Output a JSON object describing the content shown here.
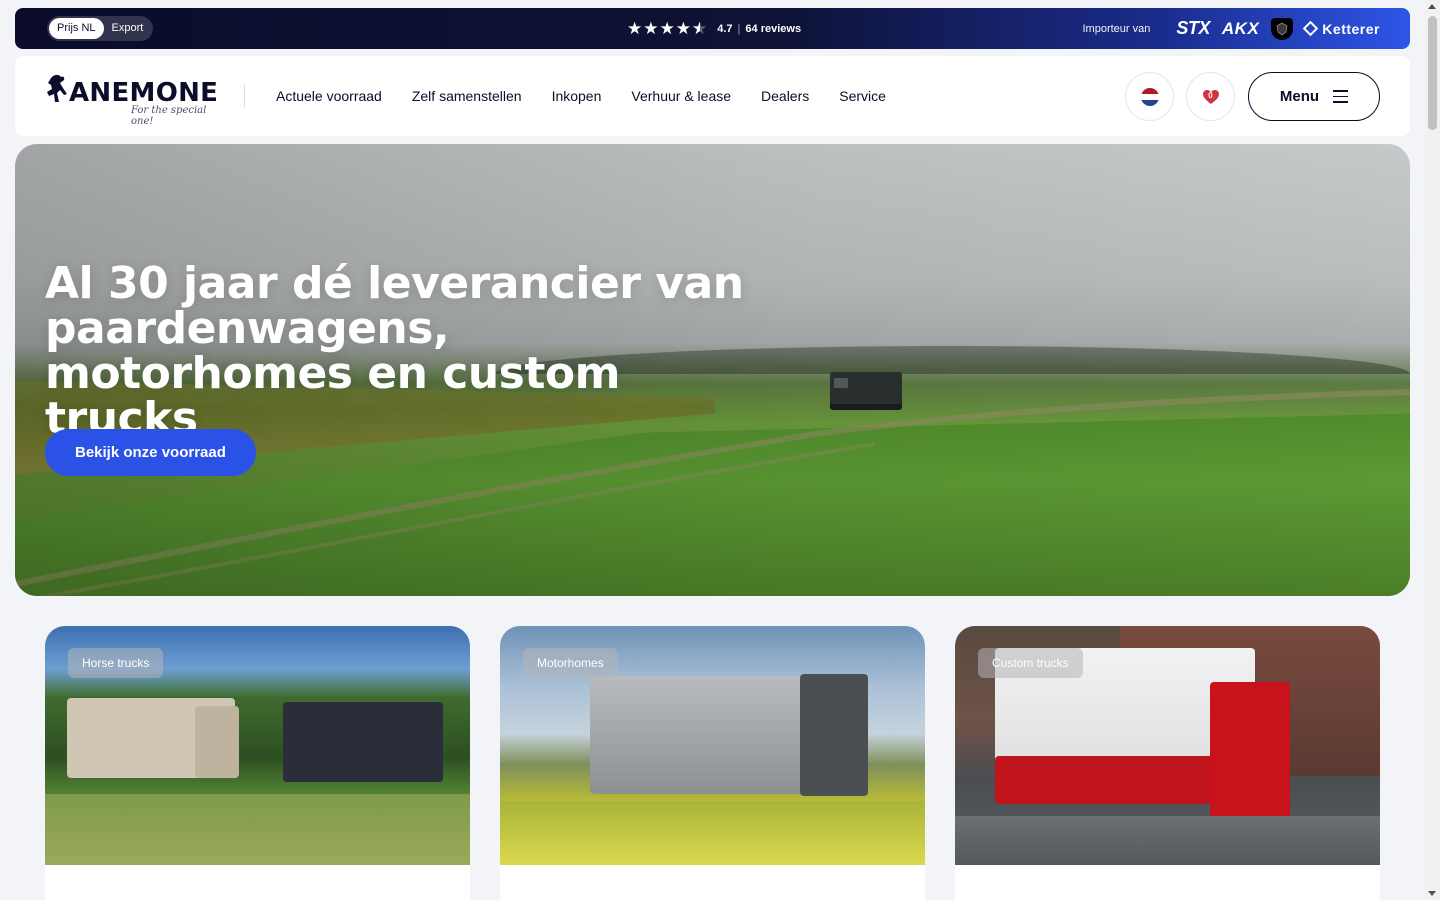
{
  "topbar": {
    "price_options": [
      "Prijs NL",
      "Export"
    ],
    "price_active": "Prijs NL",
    "rating_value": "4.7",
    "stars": 4.5,
    "reviews_label": "64 reviews",
    "importer_label": "Importeur van",
    "brands": [
      "STX",
      "AKX",
      "Ketterer"
    ]
  },
  "header": {
    "logo_text": "ANEMONE",
    "logo_tagline": "For the special one!",
    "nav": [
      "Actuele voorraad",
      "Zelf samenstellen",
      "Inkopen",
      "Verhuur & lease",
      "Dealers",
      "Service"
    ],
    "favorites_count": "0",
    "menu_label": "Menu"
  },
  "hero": {
    "title": "Al 30 jaar dé leverancier van paardenwagens, motorhomes en custom trucks",
    "cta_label": "Bekijk onze voorraad"
  },
  "categories": [
    {
      "tag": "Horse trucks"
    },
    {
      "tag": "Motorhomes"
    },
    {
      "tag": "Custom trucks"
    }
  ],
  "colors": {
    "accent": "#2b52e6",
    "dark": "#0b0d2a",
    "flag_red": "#ae1c28",
    "flag_blue": "#21468b",
    "heart": "#d0343f"
  }
}
